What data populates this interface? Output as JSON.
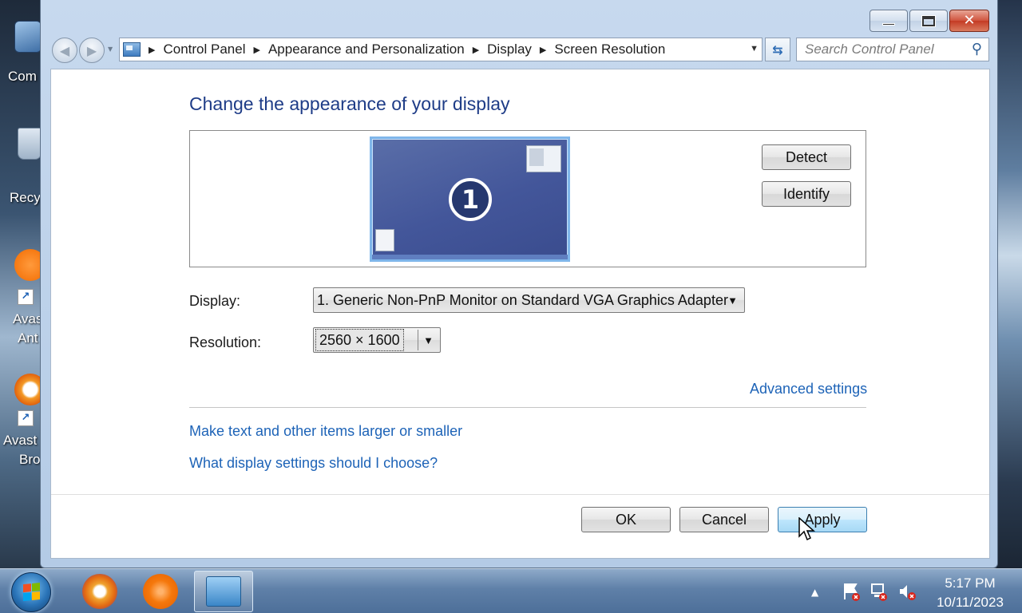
{
  "desktop": {
    "icons": [
      {
        "label": "Com"
      },
      {
        "label": "Recy"
      },
      {
        "label_line1": "Avas",
        "label_line2": "Ant"
      },
      {
        "label_line1": "Avast",
        "label_line2": "Bro"
      }
    ]
  },
  "window": {
    "caption_buttons": [
      "minimize",
      "maximize",
      "close"
    ],
    "close_glyph": "✕"
  },
  "address_bar": {
    "breadcrumbs": [
      "Control Panel",
      "Appearance and Personalization",
      "Display",
      "Screen Resolution"
    ],
    "search_placeholder": "Search Control Panel"
  },
  "content": {
    "heading": "Change the appearance of your display",
    "monitor_number": "1",
    "detect_label": "Detect",
    "identify_label": "Identify",
    "display_label": "Display:",
    "display_value": "1. Generic Non-PnP Monitor on Standard VGA Graphics Adapter",
    "resolution_label": "Resolution:",
    "resolution_value": "2560 × 1600",
    "advanced_settings": "Advanced settings",
    "link_text_size": "Make text and other items larger or smaller",
    "link_what_settings": "What display settings should I choose?",
    "ok_label": "OK",
    "cancel_label": "Cancel",
    "apply_label": "Apply"
  },
  "taskbar": {
    "time": "5:17 PM",
    "date": "10/11/2023",
    "tray_arrow": "▲"
  },
  "colors": {
    "heading": "#1e3c87",
    "link": "#1d63b7",
    "monitor": "#43569a",
    "apply_button": "#bee6fd"
  }
}
